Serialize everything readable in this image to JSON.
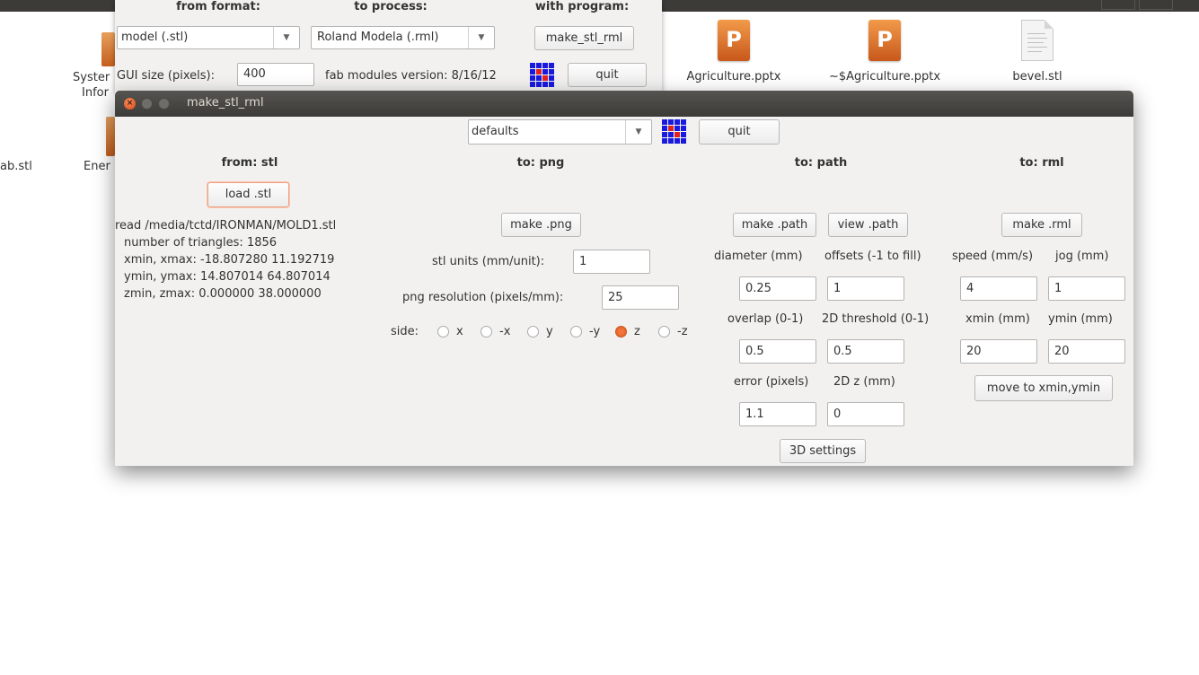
{
  "desktop": {
    "partial_left_label": "ab.stl",
    "partial_system_label_1": "Syster",
    "partial_system_label_2": "Infor",
    "partial_energy_label": "Ener",
    "files": [
      {
        "name": "Agriculture.pptx",
        "icon": "pptx-file-icon",
        "glyph": "P"
      },
      {
        "name": "~$Agriculture.pptx",
        "icon": "pptx-file-icon",
        "glyph": "P"
      },
      {
        "name": "bevel.stl",
        "icon": "stl-file-icon"
      }
    ]
  },
  "back_window": {
    "col_headers": {
      "from": "from format:",
      "to": "to process:",
      "with": "with program:"
    },
    "from_format_value": "model (.stl)",
    "to_process_value": "Roland Modela (.rml)",
    "program_button": "make_stl_rml",
    "gui_size_label": "GUI size (pixels):",
    "gui_size_value": "400",
    "version_label": "fab modules version: 8/16/12",
    "quit_label": "quit"
  },
  "front_window": {
    "title": "make_stl_rml",
    "defaults_value": "defaults",
    "quit_label": "quit",
    "stl_col": {
      "header": "from: stl",
      "load_button": "load .stl",
      "info": [
        "read /media/tctd/IRONMAN/MOLD1.stl",
        "number of triangles: 1856",
        "xmin, xmax: -18.807280 11.192719",
        "ymin, ymax: 14.807014 64.807014",
        "zmin, zmax: 0.000000 38.000000"
      ]
    },
    "png_col": {
      "header": "to: png",
      "make_button": "make .png",
      "stl_units_label": "stl units (mm/unit):",
      "stl_units_value": "1",
      "png_res_label": "png resolution (pixels/mm):",
      "png_res_value": "25",
      "side_label": "side:",
      "sides": [
        "x",
        "-x",
        "y",
        "-y",
        "z",
        "-z"
      ],
      "selected_side": "z"
    },
    "path_col": {
      "header": "to: path",
      "make_button": "make .path",
      "view_button": "view .path",
      "diameter_label": "diameter (mm)",
      "diameter_value": "0.25",
      "offsets_label": "offsets (-1 to fill)",
      "offsets_value": "1",
      "overlap_label": "overlap (0-1)",
      "overlap_value": "0.5",
      "threshold_label": "2D threshold (0-1)",
      "threshold_value": "0.5",
      "error_label": "error (pixels)",
      "error_value": "1.1",
      "z_label": "2D z (mm)",
      "z_value": "0",
      "settings_button": "3D settings"
    },
    "rml_col": {
      "header": "to: rml",
      "make_button": "make .rml",
      "speed_label": "speed (mm/s)",
      "speed_value": "4",
      "jog_label": "jog (mm)",
      "jog_value": "1",
      "xmin_label": "xmin (mm)",
      "xmin_value": "20",
      "ymin_label": "ymin (mm)",
      "ymin_value": "20",
      "move_button": "move to xmin,ymin"
    }
  }
}
